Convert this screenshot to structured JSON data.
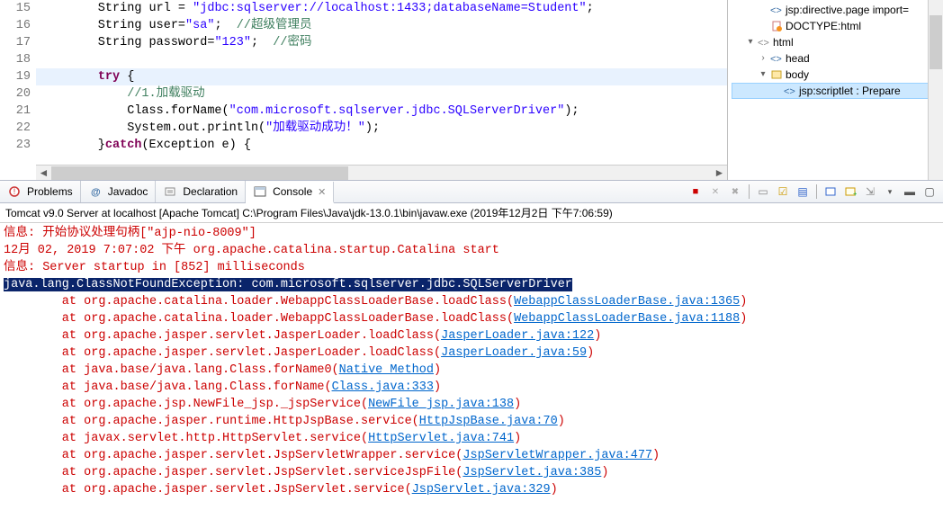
{
  "editor": {
    "lines": [
      {
        "n": "15",
        "segs": [
          {
            "t": "        String url = ",
            "c": "plain"
          },
          {
            "t": "\"jdbc:sqlserver://localhost:1433;databaseName=Student\"",
            "c": "str"
          },
          {
            "t": ";",
            "c": "plain"
          }
        ]
      },
      {
        "n": "16",
        "segs": [
          {
            "t": "        String user=",
            "c": "plain"
          },
          {
            "t": "\"sa\"",
            "c": "str"
          },
          {
            "t": ";  ",
            "c": "plain"
          },
          {
            "t": "//超级管理员",
            "c": "cmt"
          }
        ]
      },
      {
        "n": "17",
        "segs": [
          {
            "t": "        String password=",
            "c": "plain"
          },
          {
            "t": "\"123\"",
            "c": "str"
          },
          {
            "t": ";  ",
            "c": "plain"
          },
          {
            "t": "//密码",
            "c": "cmt"
          }
        ]
      },
      {
        "n": "18",
        "segs": [
          {
            "t": "        ",
            "c": "plain"
          }
        ]
      },
      {
        "n": "19",
        "hl": true,
        "segs": [
          {
            "t": "        ",
            "c": "plain"
          },
          {
            "t": "try",
            "c": "kw"
          },
          {
            "t": " {",
            "c": "plain"
          }
        ]
      },
      {
        "n": "20",
        "segs": [
          {
            "t": "            ",
            "c": "plain"
          },
          {
            "t": "//1.加载驱动",
            "c": "cmt"
          }
        ]
      },
      {
        "n": "21",
        "segs": [
          {
            "t": "            Class.forName(",
            "c": "plain"
          },
          {
            "t": "\"com.microsoft.sqlserver.jdbc.SQLServerDriver\"",
            "c": "str"
          },
          {
            "t": ");",
            "c": "plain"
          }
        ]
      },
      {
        "n": "22",
        "segs": [
          {
            "t": "            System.out.println(",
            "c": "plain"
          },
          {
            "t": "\"加载驱动成功！\"",
            "c": "str"
          },
          {
            "t": ");",
            "c": "plain"
          }
        ]
      },
      {
        "n": "23",
        "segs": [
          {
            "t": "        }",
            "c": "plain"
          },
          {
            "t": "catch",
            "c": "kw"
          },
          {
            "t": "(Exception e) {",
            "c": "plain"
          }
        ]
      }
    ]
  },
  "outline": {
    "items": [
      {
        "indent": 2,
        "expand": "",
        "icon": "tag-blue",
        "label": "jsp:directive.page import=",
        "extra": ""
      },
      {
        "indent": 2,
        "expand": "",
        "icon": "doc-orange",
        "label": "DOCTYPE:html"
      },
      {
        "indent": 1,
        "expand": "▾",
        "icon": "tag-gray",
        "label": "html"
      },
      {
        "indent": 2,
        "expand": "›",
        "icon": "tag-blue",
        "label": "head"
      },
      {
        "indent": 2,
        "expand": "▾",
        "icon": "tag-yellow",
        "label": "body"
      },
      {
        "indent": 3,
        "expand": "",
        "icon": "tag-blue",
        "label": "jsp:scriptlet : Prepare",
        "sel": true
      }
    ]
  },
  "tabs": {
    "problems": "Problems",
    "javadoc": "Javadoc",
    "declaration": "Declaration",
    "console": "Console"
  },
  "console": {
    "header": "Tomcat v9.0 Server at localhost [Apache Tomcat] C:\\Program Files\\Java\\jdk-13.0.1\\bin\\javaw.exe (2019年12月2日 下午7:06:59)",
    "lines": [
      {
        "segs": [
          {
            "t": "信息: 开始协议处理句柄[\"ajp-nio-8009\"]",
            "c": "c-red"
          }
        ]
      },
      {
        "segs": [
          {
            "t": "12月 02, 2019 7:07:02 下午 org.apache.catalina.startup.Catalina start",
            "c": "c-red"
          }
        ]
      },
      {
        "segs": [
          {
            "t": "信息: Server startup in [852] milliseconds",
            "c": "c-red"
          }
        ]
      },
      {
        "segs": [
          {
            "t": "java.lang.ClassNotFoundException: com.microsoft.sqlserver.jdbc.SQLServerDriver",
            "c": "c-hl"
          }
        ]
      },
      {
        "segs": [
          {
            "t": "        at org.apache.catalina.loader.WebappClassLoaderBase.loadClass(",
            "c": "c-red"
          },
          {
            "t": "WebappClassLoaderBase.java:1365",
            "c": "c-link"
          },
          {
            "t": ")",
            "c": "c-red"
          }
        ]
      },
      {
        "segs": [
          {
            "t": "        at org.apache.catalina.loader.WebappClassLoaderBase.loadClass(",
            "c": "c-red"
          },
          {
            "t": "WebappClassLoaderBase.java:1188",
            "c": "c-link"
          },
          {
            "t": ")",
            "c": "c-red"
          }
        ]
      },
      {
        "segs": [
          {
            "t": "        at org.apache.jasper.servlet.JasperLoader.loadClass(",
            "c": "c-red"
          },
          {
            "t": "JasperLoader.java:122",
            "c": "c-link"
          },
          {
            "t": ")",
            "c": "c-red"
          }
        ]
      },
      {
        "segs": [
          {
            "t": "        at org.apache.jasper.servlet.JasperLoader.loadClass(",
            "c": "c-red"
          },
          {
            "t": "JasperLoader.java:59",
            "c": "c-link"
          },
          {
            "t": ")",
            "c": "c-red"
          }
        ]
      },
      {
        "segs": [
          {
            "t": "        at java.base/java.lang.Class.forName0(",
            "c": "c-red"
          },
          {
            "t": "Native Method",
            "c": "c-link"
          },
          {
            "t": ")",
            "c": "c-red"
          }
        ]
      },
      {
        "segs": [
          {
            "t": "        at java.base/java.lang.Class.forName(",
            "c": "c-red"
          },
          {
            "t": "Class.java:333",
            "c": "c-link"
          },
          {
            "t": ")",
            "c": "c-red"
          }
        ]
      },
      {
        "segs": [
          {
            "t": "        at org.apache.jsp.NewFile_jsp._jspService(",
            "c": "c-red"
          },
          {
            "t": "NewFile_jsp.java:138",
            "c": "c-link"
          },
          {
            "t": ")",
            "c": "c-red"
          }
        ]
      },
      {
        "segs": [
          {
            "t": "        at org.apache.jasper.runtime.HttpJspBase.service(",
            "c": "c-red"
          },
          {
            "t": "HttpJspBase.java:70",
            "c": "c-link"
          },
          {
            "t": ")",
            "c": "c-red"
          }
        ]
      },
      {
        "segs": [
          {
            "t": "        at javax.servlet.http.HttpServlet.service(",
            "c": "c-red"
          },
          {
            "t": "HttpServlet.java:741",
            "c": "c-link"
          },
          {
            "t": ")",
            "c": "c-red"
          }
        ]
      },
      {
        "segs": [
          {
            "t": "        at org.apache.jasper.servlet.JspServletWrapper.service(",
            "c": "c-red"
          },
          {
            "t": "JspServletWrapper.java:477",
            "c": "c-link"
          },
          {
            "t": ")",
            "c": "c-red"
          }
        ]
      },
      {
        "segs": [
          {
            "t": "        at org.apache.jasper.servlet.JspServlet.serviceJspFile(",
            "c": "c-red"
          },
          {
            "t": "JspServlet.java:385",
            "c": "c-link"
          },
          {
            "t": ")",
            "c": "c-red"
          }
        ]
      },
      {
        "segs": [
          {
            "t": "        at org.apache.jasper.servlet.JspServlet.service(",
            "c": "c-red"
          },
          {
            "t": "JspServlet.java:329",
            "c": "c-link"
          },
          {
            "t": ")",
            "c": "c-red"
          }
        ]
      }
    ]
  },
  "icons": {
    "stop": "■",
    "x1": "✕",
    "x2": "✖",
    "clear": "▭",
    "lock": "☑",
    "doc": "▤",
    "up": "↕",
    "pin": "⇲",
    "menu": "▾",
    "min": "▬",
    "max": "▢"
  }
}
